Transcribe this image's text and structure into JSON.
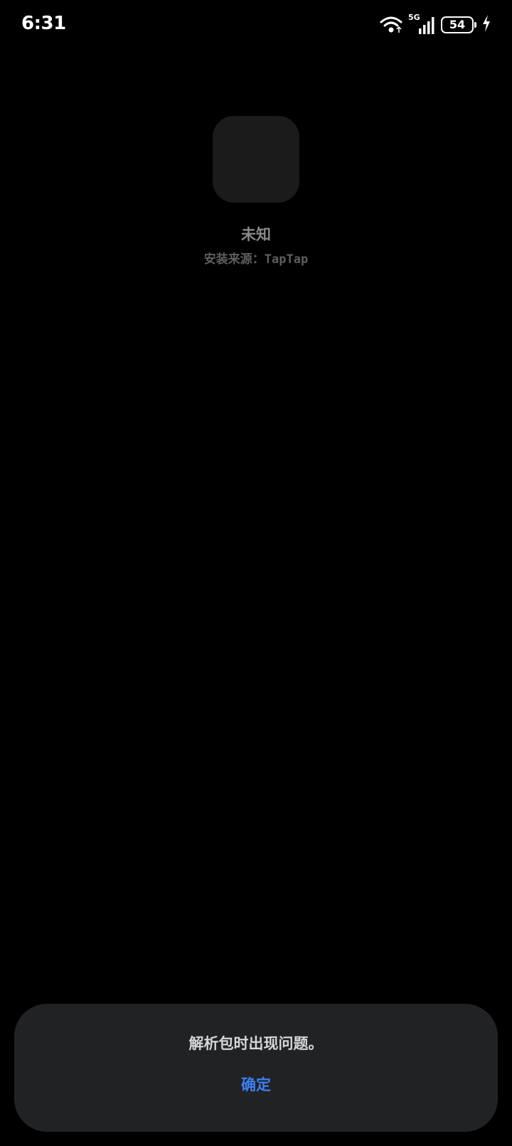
{
  "status_bar": {
    "time": "6:31",
    "network_type": "5G",
    "battery_level": "54",
    "icons": [
      "wifi-icon",
      "signal-icon",
      "battery-icon",
      "charging-icon"
    ]
  },
  "app": {
    "name": "未知",
    "install_source": "安装来源：TapTap"
  },
  "dialog": {
    "message": "解析包时出现问题。",
    "confirm_label": "确定",
    "accent_color": "#3e7ef5"
  }
}
